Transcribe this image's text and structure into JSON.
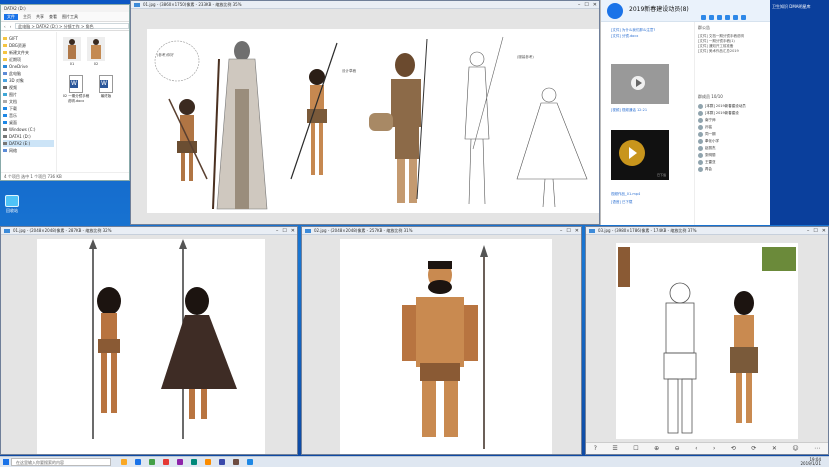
{
  "colors": {
    "desktop": "#1565c0",
    "accent": "#1a73e8",
    "qq_link": "#2b6fd1"
  },
  "desktop": {
    "icon_label": "回收站",
    "icon": "recycle-bin-icon"
  },
  "explorer": {
    "title": "DATA2 (D:)",
    "ribbon": [
      "文件",
      "主页",
      "共享",
      "查看",
      "图片工具"
    ],
    "address": "此电脑 > DATA2 (D:) > 分镜工作 > 角色",
    "search_placeholder": "搜索",
    "sidebar": [
      "GIFT",
      "DBG资源",
      "新建文件夹",
      "近期项",
      "OneDrive",
      "此电脑",
      "3D 对象",
      "视频",
      "图片",
      "文档",
      "下载",
      "音乐",
      "桌面",
      "Windows (C:)",
      "DATA1 (D:)",
      "DATA2 (E:)",
      "网络"
    ],
    "files": [
      {
        "name": "01",
        "type": "image"
      },
      {
        "name": "02",
        "type": "image"
      },
      {
        "name": "02 一期分镜手稿说明.docx",
        "type": "doc"
      },
      {
        "name": "最终版",
        "type": "doc"
      }
    ],
    "status": "4 个项目   选中 1 个项目  736 KB"
  },
  "viewers": [
    {
      "title": "01.jpg - (3860×1750)像素 - 233KB - 缩放比例 35%",
      "tools": [
        "?",
        "⊕",
        "⊖",
        "⟲",
        "⟳",
        "✕"
      ]
    },
    {
      "title": "01.jpg - (2048×2048)像素 - 287KB - 缩放比例 32%"
    },
    {
      "title": "02.jpg - (2048×2048)像素 - 257KB - 缩放比例 31%"
    },
    {
      "title": "03.jpg - (3980×1786)像素 - 174KB - 缩放比例 37%",
      "tools": [
        "?",
        "☰",
        "☐",
        "⊕",
        "⊖",
        "‹",
        "›",
        "⟲",
        "⟳",
        "✕",
        "☺",
        "⋯"
      ]
    }
  ],
  "sketch_notes": [
    "(参考)你好",
    "设计草稿",
    "(服装参考)"
  ],
  "chat": {
    "group_name": "2019新春建设动员(8)",
    "messages": [
      "[文件] 为什么我们那么注意?",
      "[文件] 分镜.docx",
      "[视频] 视频通话 12:21",
      "[语音] 已下载",
      "视频作品_01.mp4"
    ],
    "audio_tag": "已下载",
    "announcement_title": "群公告",
    "announcements": [
      "[文件] 文档一期分镜手稿说明",
      "[文件] 一期分镜手稿(1)",
      "[文件] 通知开工前准备",
      "[文件] 美术作品汇总2019"
    ],
    "members_title": "群成员 10/10",
    "members": [
      "[本群] 2019新春建设动员",
      "[本群] 2019新春建设",
      "南宁师",
      "孙铭",
      "同一期",
      "奉化小学",
      "赵丽杰",
      "张明丽",
      "王雷亚",
      "再会"
    ]
  },
  "right_panel": {
    "title": "卫生知识  DMA明星库"
  },
  "taskbar": {
    "search_placeholder": "在这里输入你要搜索的内容",
    "time": "19:04",
    "date": "2019/1/21",
    "app_colors": [
      "#f9a825",
      "#1a73e8",
      "#43a047",
      "#e53935",
      "#8e24aa",
      "#00897b",
      "#fb8c00",
      "#3949ab",
      "#6d4c41",
      "#1e88e5"
    ]
  }
}
